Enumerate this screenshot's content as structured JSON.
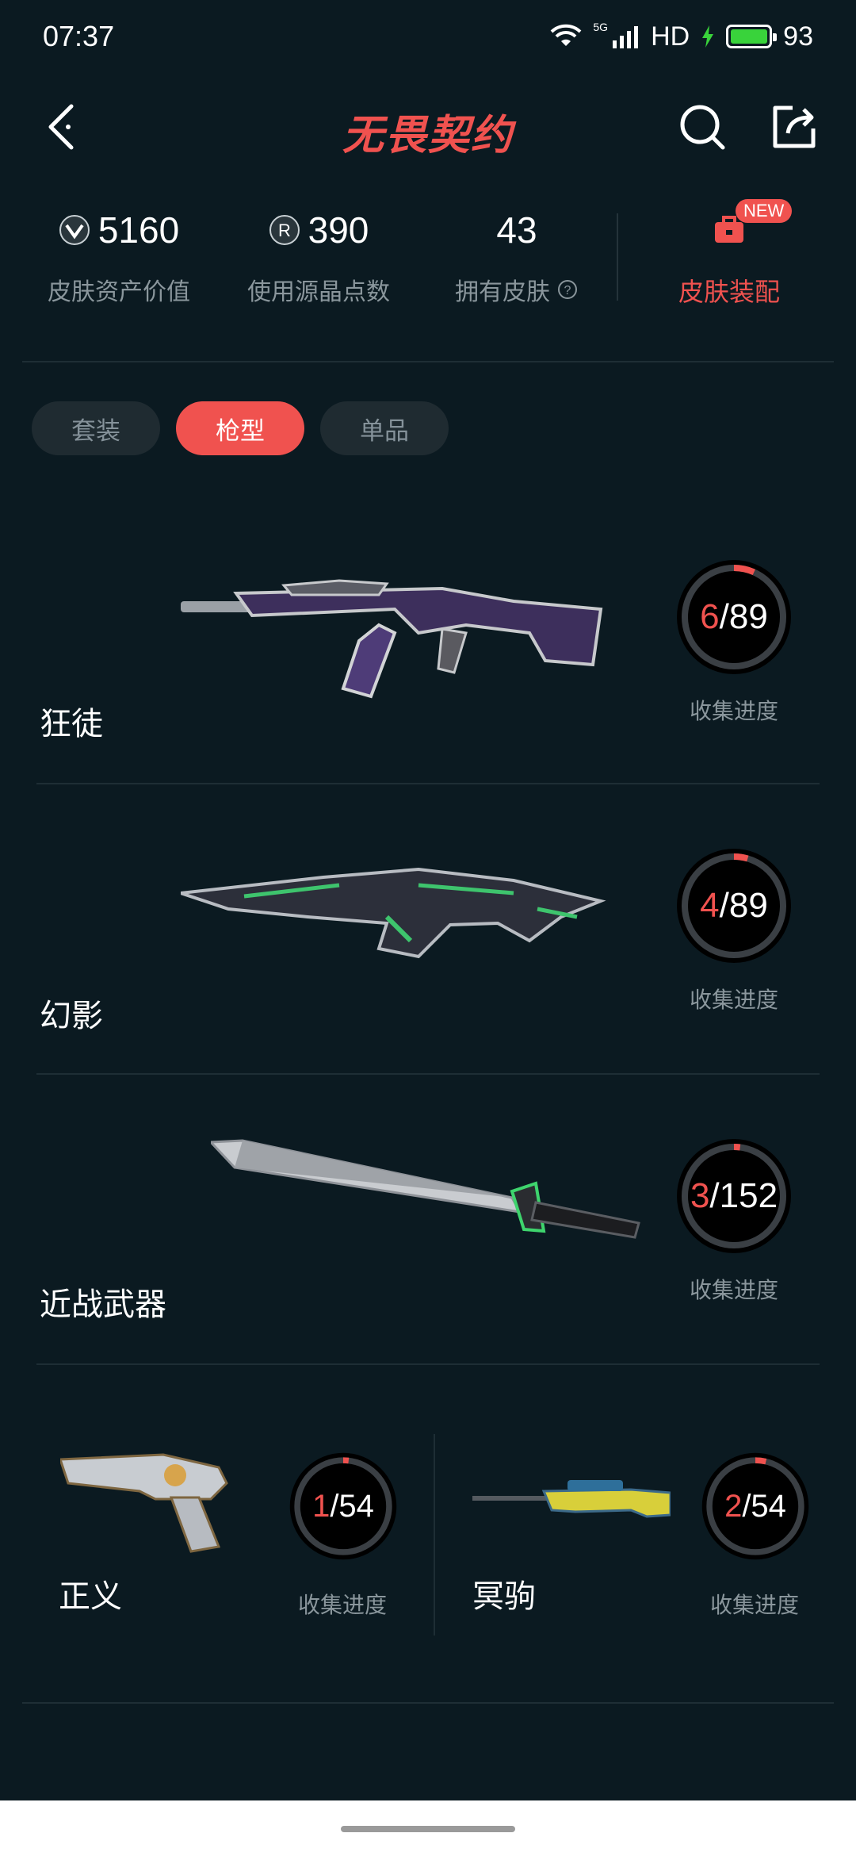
{
  "status": {
    "time": "07:37",
    "network": "5G",
    "hd": "HD",
    "battery": "93"
  },
  "header": {
    "title": "无畏契约"
  },
  "stats": {
    "asset_value": "5160",
    "asset_value_label": "皮肤资产价值",
    "radianite": "390",
    "radianite_label": "使用源晶点数",
    "owned_skins": "43",
    "owned_skins_label": "拥有皮肤",
    "equip_label": "皮肤装配",
    "equip_badge": "NEW"
  },
  "tabs": [
    {
      "label": "套装"
    },
    {
      "label": "枪型"
    },
    {
      "label": "单品"
    }
  ],
  "weapons": [
    {
      "name": "狂徒",
      "current": "6",
      "total": "/89",
      "progress_label": "收集进度",
      "progress": 0.067
    },
    {
      "name": "幻影",
      "current": "4",
      "total": "/89",
      "progress_label": "收集进度",
      "progress": 0.045
    },
    {
      "name": "近战武器",
      "current": "3",
      "total": "/152",
      "progress_label": "收集进度",
      "progress": 0.02
    },
    {
      "name": "正义",
      "current": "1",
      "total": "/54",
      "progress_label": "收集进度",
      "progress": 0.019
    },
    {
      "name": "冥驹",
      "current": "2",
      "total": "/54",
      "progress_label": "收集进度",
      "progress": 0.037
    }
  ],
  "colors": {
    "accent": "#f0524f",
    "background": "#0b1a21",
    "muted": "#8a969c"
  }
}
